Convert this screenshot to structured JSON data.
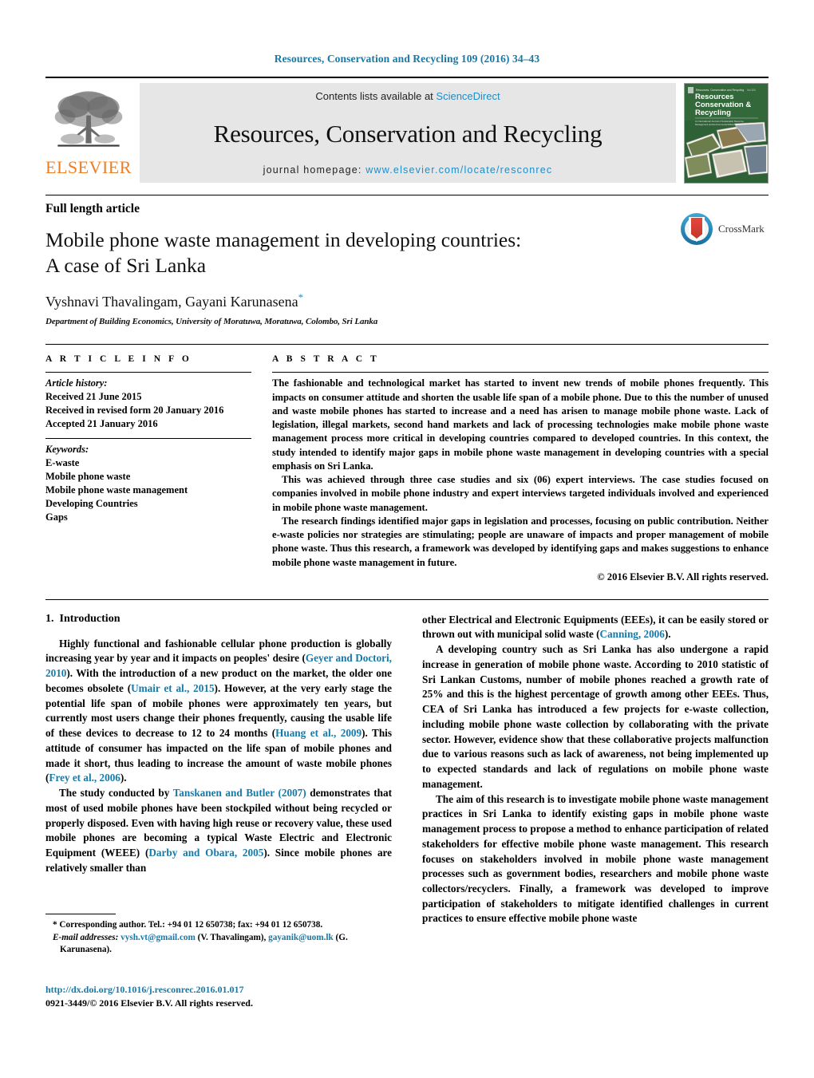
{
  "running_head": "Resources, Conservation and Recycling 109 (2016) 34–43",
  "masthead": {
    "contents_prefix": "Contents lists available at ",
    "sciencedirect": "ScienceDirect",
    "journal_title": "Resources, Conservation and Recycling",
    "homepage_prefix": "journal homepage: ",
    "homepage_url": "www.elsevier.com/locate/resconrec",
    "publisher": "ELSEVIER",
    "cover_title_lines": [
      "Resources",
      "Conservation &",
      "Recycling"
    ],
    "link_color": "#1f8dc6",
    "publisher_color": "#ef7d22"
  },
  "article": {
    "kicker": "Full length article",
    "title_line1": "Mobile phone waste management in developing countries:",
    "title_line2": "A case of Sri Lanka",
    "authors": "Vyshnavi Thavalingam, Gayani Karunasena",
    "corresponding_marker": "*",
    "affiliation": "Department of Building Economics, University of Moratuwa, Moratuwa, Colombo, Sri Lanka",
    "crossmark_label": "CrossMark"
  },
  "article_info": {
    "heading": "A R T I C L E   I N F O",
    "history_label": "Article history:",
    "history": [
      "Received 21 June 2015",
      "Received in revised form 20 January 2016",
      "Accepted 21 January 2016"
    ],
    "keywords_label": "Keywords:",
    "keywords": [
      "E-waste",
      "Mobile phone waste",
      "Mobile phone waste management",
      "Developing Countries",
      "Gaps"
    ]
  },
  "abstract": {
    "heading": "A B S T R A C T",
    "paragraphs": [
      "The fashionable and technological market has started to invent new trends of mobile phones frequently. This impacts on consumer attitude and shorten the usable life span of a mobile phone. Due to this the number of unused and waste mobile phones has started to increase and a need has arisen to manage mobile phone waste. Lack of legislation, illegal markets, second hand markets and lack of processing technologies make mobile phone waste management process more critical in developing countries compared to developed countries. In this context, the study intended to identify major gaps in mobile phone waste management in developing countries with a special emphasis on Sri Lanka.",
      "This was achieved through three case studies and six (06) expert interviews. The case studies focused on companies involved in mobile phone industry and expert interviews targeted individuals involved and experienced in mobile phone waste management.",
      "The research findings identified major gaps in legislation and processes, focusing on public contribution. Neither e-waste policies nor strategies are stimulating; people are unaware of impacts and proper management of mobile phone waste. Thus this research, a framework was developed by identifying gaps and makes suggestions to enhance mobile phone waste management in future."
    ],
    "copyright": "© 2016 Elsevier B.V. All rights reserved."
  },
  "introduction": {
    "section_number": "1.",
    "section_title": "Introduction",
    "left_paragraphs": [
      "Highly functional and fashionable cellular phone production is globally increasing year by year and it impacts on peoples' desire (Geyer and Doctori, 2010). With the introduction of a new product on the market, the older one becomes obsolete (Umair et al., 2015). However, at the very early stage the potential life span of mobile phones were approximately ten years, but currently most users change their phones frequently, causing the usable life of these devices to decrease to 12 to 24 months (Huang et al., 2009). This attitude of consumer has impacted on the life span of mobile phones and made it short, thus leading to increase the amount of waste mobile phones (Frey et al., 2006).",
      "The study conducted by Tanskanen and Butler (2007) demonstrates that most of used mobile phones have been stockpiled without being recycled or properly disposed. Even with having high reuse or recovery value, these used mobile phones are becoming a typical Waste Electric and Electronic Equipment (WEEE) (Darby and Obara, 2005). Since mobile phones are relatively smaller than"
    ],
    "right_paragraphs": [
      "other Electrical and Electronic Equipments (EEEs), it can be easily stored or thrown out with municipal solid waste (Canning, 2006).",
      "A developing country such as Sri Lanka has also undergone a rapid increase in generation of mobile phone waste. According to 2010 statistic of Sri Lankan Customs, number of mobile phones reached a growth rate of 25% and this is the highest percentage of growth among other EEEs. Thus, CEA of Sri Lanka has introduced a few projects for e-waste collection, including mobile phone waste collection by collaborating with the private sector. However, evidence show that these collaborative projects malfunction due to various reasons such as lack of awareness, not being implemented up to expected standards and lack of regulations on mobile phone waste management.",
      "The aim of this research is to investigate mobile phone waste management practices in Sri Lanka to identify existing gaps in mobile phone waste management process to propose a method to enhance participation of related stakeholders for effective mobile phone waste management. This research focuses on stakeholders involved in mobile phone waste management processes such as government bodies, researchers and mobile phone waste collectors/recyclers. Finally, a framework was developed to improve participation of stakeholders to mitigate identified challenges in current practices to ensure effective mobile phone waste"
    ],
    "citations": [
      "Geyer and Doctori, 2010",
      "Umair et al., 2015",
      "Huang et al., 2009",
      "Frey et al., 2006",
      "Tanskanen and Butler (2007)",
      "Darby and Obara, 2005",
      "Canning, 2006"
    ]
  },
  "footnotes": {
    "corresponding_marker": "*",
    "corresponding_text": "Corresponding author. Tel.: +94 01 12 650738; fax: +94 01 12 650738.",
    "email_label": "E-mail addresses:",
    "email1": "vysh.vt@gmail.com",
    "email1_owner": "(V. Thavalingam)",
    "email2": "gayanik@uom.lk",
    "email2_owner": "(G. Karunasena).",
    "doi": "http://dx.doi.org/10.1016/j.resconrec.2016.01.017",
    "issn_line": "0921-3449/© 2016 Elsevier B.V. All rights reserved."
  }
}
